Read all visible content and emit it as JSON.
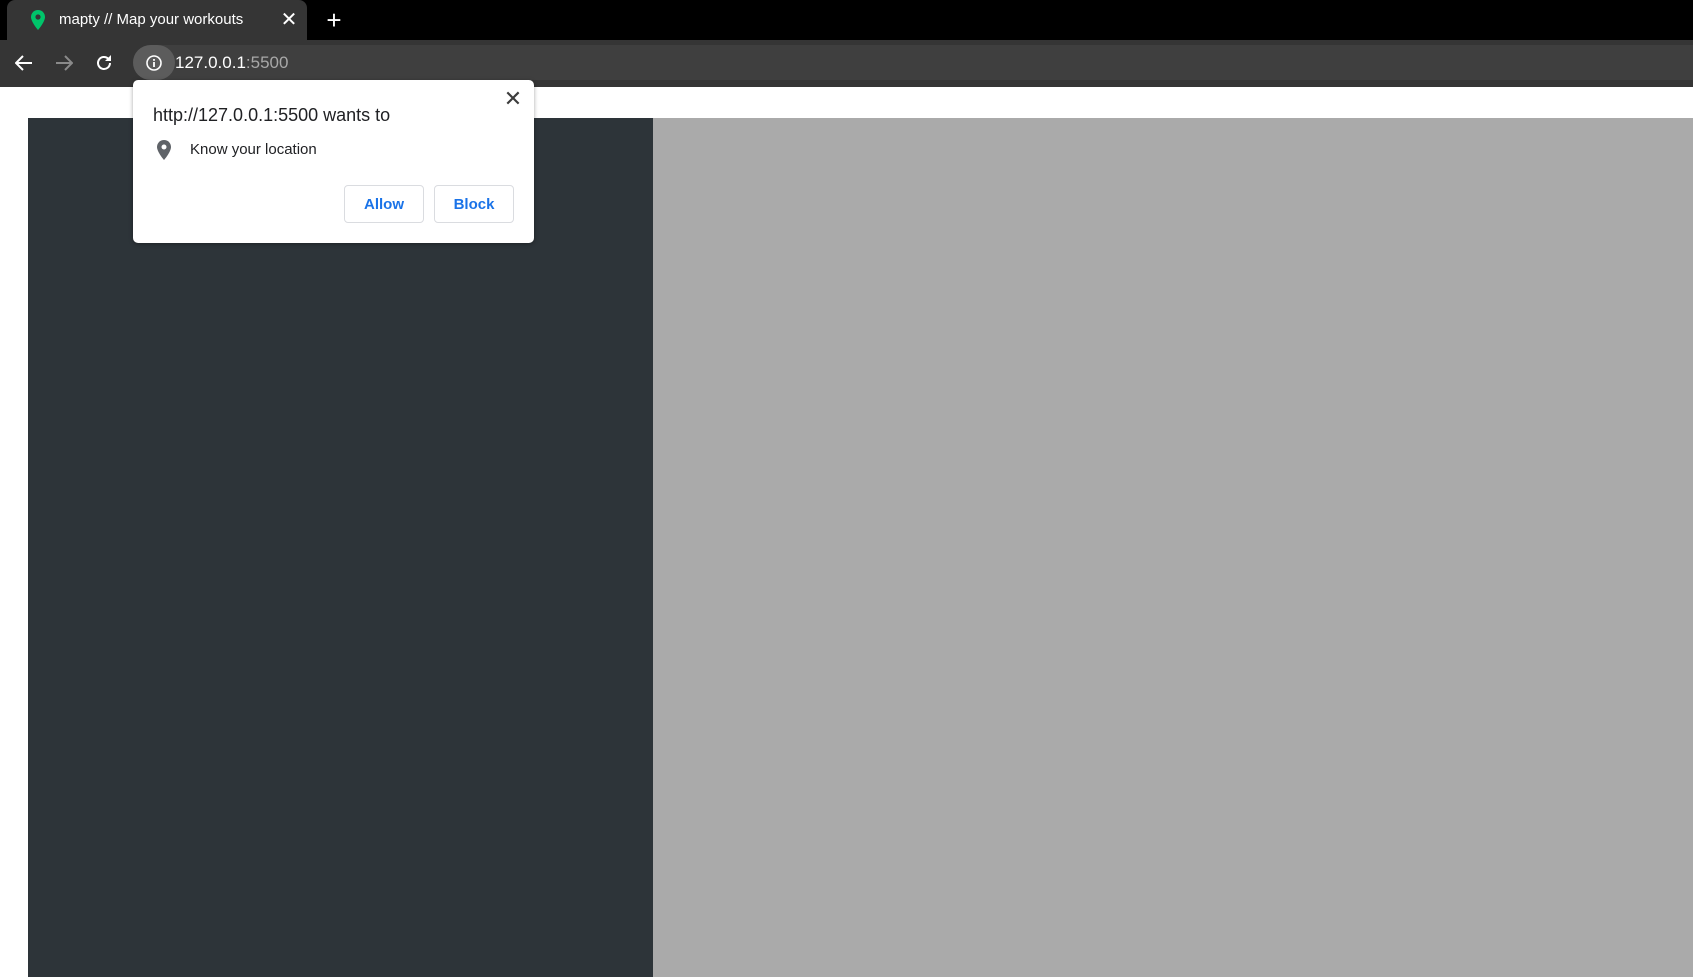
{
  "browser": {
    "tab": {
      "title": "mapty // Map your workouts",
      "favicon": "map-pin-icon",
      "favicon_color": "#00c46a"
    },
    "new_tab_label": "+",
    "tab_close_label": "✕",
    "address": {
      "host": "127.0.0.1",
      "port": ":5500",
      "security_icon": "info-icon"
    },
    "nav": {
      "back_icon": "arrow-left-icon",
      "forward_icon": "arrow-right-icon",
      "reload_icon": "reload-icon"
    }
  },
  "permission_prompt": {
    "title": "http://127.0.0.1:5500 wants to",
    "permission": "Know your location",
    "permission_icon": "location-pin-icon",
    "close_label": "✕",
    "allow_label": "Allow",
    "block_label": "Block"
  },
  "page": {
    "sidebar_color": "#2d3439",
    "map_color": "#aaaaaa"
  }
}
